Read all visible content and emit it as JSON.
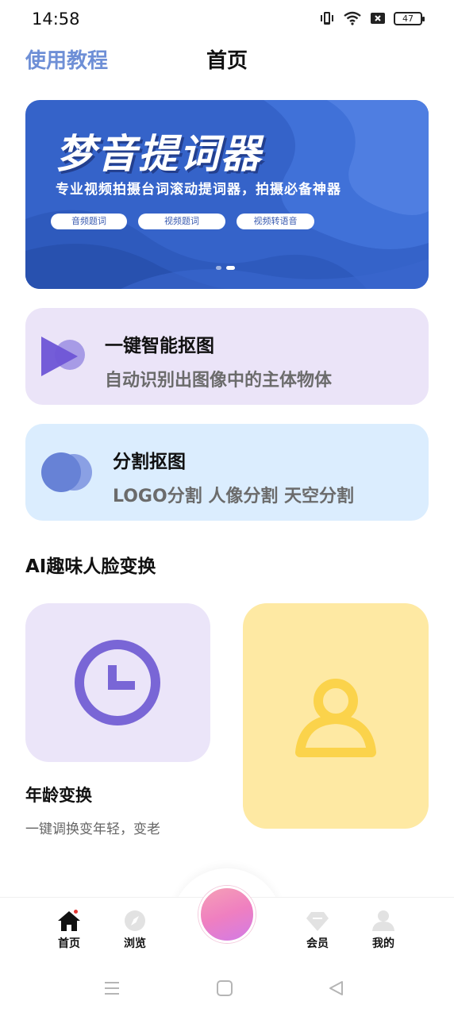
{
  "status_bar": {
    "time": "14:58",
    "battery": "47"
  },
  "header": {
    "tutorial_link": "使用教程",
    "title": "首页"
  },
  "banner": {
    "title": "梦音提词器",
    "subtitle": "专业视频拍摄台词滚动提词器，拍摄必备神器",
    "tags": [
      "音频题词",
      "视频题词",
      "视频转语音"
    ],
    "page_indicator": {
      "count": 2,
      "active": 2
    }
  },
  "cards": [
    {
      "title": "一键智能抠图",
      "subtitle": "自动识别出图像中的主体物体"
    },
    {
      "title": "分割抠图",
      "subtitle": "LOGO分割 人像分割 天空分割"
    }
  ],
  "section": {
    "title": "AI趣味人脸变换",
    "age_tile": {
      "title": "年龄变换",
      "subtitle": "一键调换变年轻，变老"
    }
  },
  "bottom_nav": {
    "items": [
      {
        "label": "首页",
        "icon": "home-icon"
      },
      {
        "label": "浏览",
        "icon": "compass-icon"
      },
      {
        "label": "会员",
        "icon": "diamond-icon"
      },
      {
        "label": "我的",
        "icon": "profile-icon"
      }
    ]
  },
  "colors": {
    "accent_blue": "#6e8fd6",
    "banner_blue": "#3563c9",
    "card_purple": "#ebe4f8",
    "card_blue": "#dbedfe",
    "tile_yellow": "#fee9a3",
    "icon_purple": "#7a68d8"
  }
}
